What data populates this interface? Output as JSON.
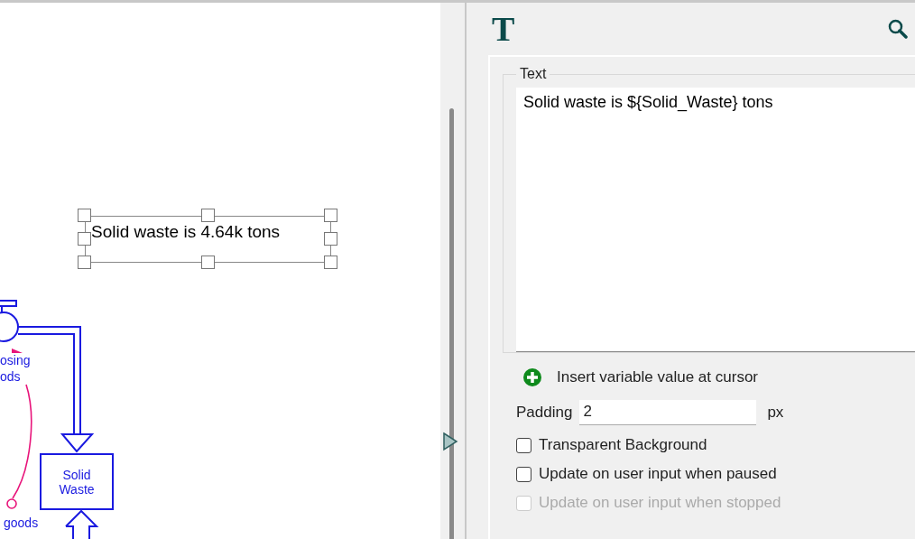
{
  "canvas": {
    "text_widget": {
      "text": "Solid waste is 4.64k tons",
      "selected": true
    },
    "flow_label": [
      "osing",
      "ods"
    ],
    "stock": {
      "label": "Solid Waste"
    },
    "converter_label": "goods"
  },
  "panel": {
    "title_icon": "T",
    "text_section": {
      "legend": "Text",
      "value": "Solid waste is ${Solid_Waste} tons"
    },
    "insert_link": "Insert variable value at cursor",
    "padding": {
      "label": "Padding",
      "value": "2",
      "unit": "px"
    },
    "options": [
      {
        "label": "Transparent Background",
        "checked": false,
        "disabled": false
      },
      {
        "label": "Update on user input when paused",
        "checked": false,
        "disabled": false
      },
      {
        "label": "Update on user input when stopped",
        "checked": false,
        "disabled": true
      }
    ]
  }
}
